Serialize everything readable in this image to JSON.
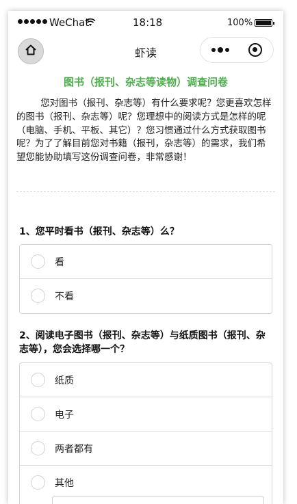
{
  "status_bar": {
    "carrier": "WeChat",
    "time": "18:18",
    "battery": "100%"
  },
  "nav": {
    "title": "虾读"
  },
  "survey": {
    "title": "图书（报刊、杂志等读物）调查问卷",
    "intro": "您对图书（报刊、杂志等）有什么要求呢？您更喜欢怎样的图书（报刊、杂志等）呢？您理想中的阅读方式是怎样的呢（电脑、手机、平板、其它）？您习惯通过什么方式获取图书呢？为了了解目前您对书籍（报刊，杂志等）的需求，我们希望您能协助填写这份调查问卷，非常感谢！"
  },
  "questions": [
    {
      "text": "1、您平时看书（报刊、杂志等）么？",
      "options": [
        "看",
        "不看"
      ]
    },
    {
      "text": "2、阅读电子图书（报刊、杂志等）与纸质图书（报刊、杂志等），您会选择哪一个？",
      "options": [
        "纸质",
        "电子",
        "两者都有",
        "其他"
      ]
    }
  ],
  "colors": {
    "title_green": "#4cae4c"
  },
  "icons": {
    "home": "home-icon",
    "more": "more-dots-icon",
    "close": "target-close-icon",
    "wifi": "wifi-icon",
    "battery": "battery-icon"
  }
}
